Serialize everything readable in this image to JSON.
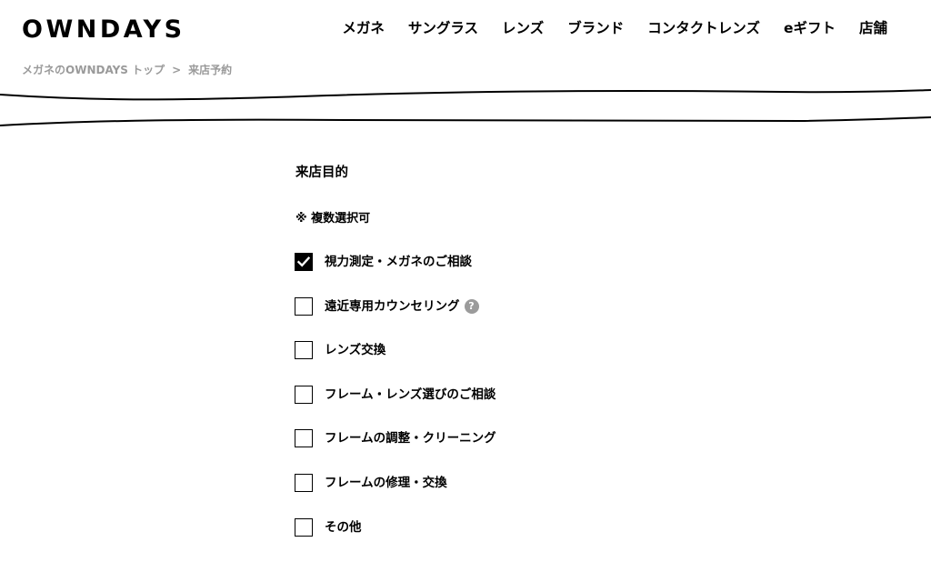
{
  "header": {
    "logo": "OWNDAYS",
    "nav": [
      {
        "label": "メガネ"
      },
      {
        "label": "サングラス"
      },
      {
        "label": "レンズ"
      },
      {
        "label": "ブランド"
      },
      {
        "label": "コンタクトレンズ"
      },
      {
        "label": "eギフト"
      },
      {
        "label": "店舗"
      }
    ]
  },
  "breadcrumb": {
    "home": "メガネのOWNDAYS トップ",
    "separator": ">",
    "current": "来店予約"
  },
  "form": {
    "section_title": "来店目的",
    "note": "※ 複数選択可",
    "options": [
      {
        "label": "視力測定・メガネのご相談",
        "checked": true
      },
      {
        "label": "遠近専用カウンセリング",
        "checked": false,
        "help_icon": "question-circle-icon",
        "help_text": "?"
      },
      {
        "label": "レンズ交換",
        "checked": false
      },
      {
        "label": "フレーム・レンズ選びのご相談",
        "checked": false
      },
      {
        "label": "フレームの調整・クリーニング",
        "checked": false
      },
      {
        "label": "フレームの修理・交換",
        "checked": false
      },
      {
        "label": "その他",
        "checked": false
      }
    ]
  },
  "colors": {
    "text": "#000000",
    "muted": "#9a9a9a",
    "help_icon_bg": "#9b9b9b",
    "background": "#ffffff"
  }
}
